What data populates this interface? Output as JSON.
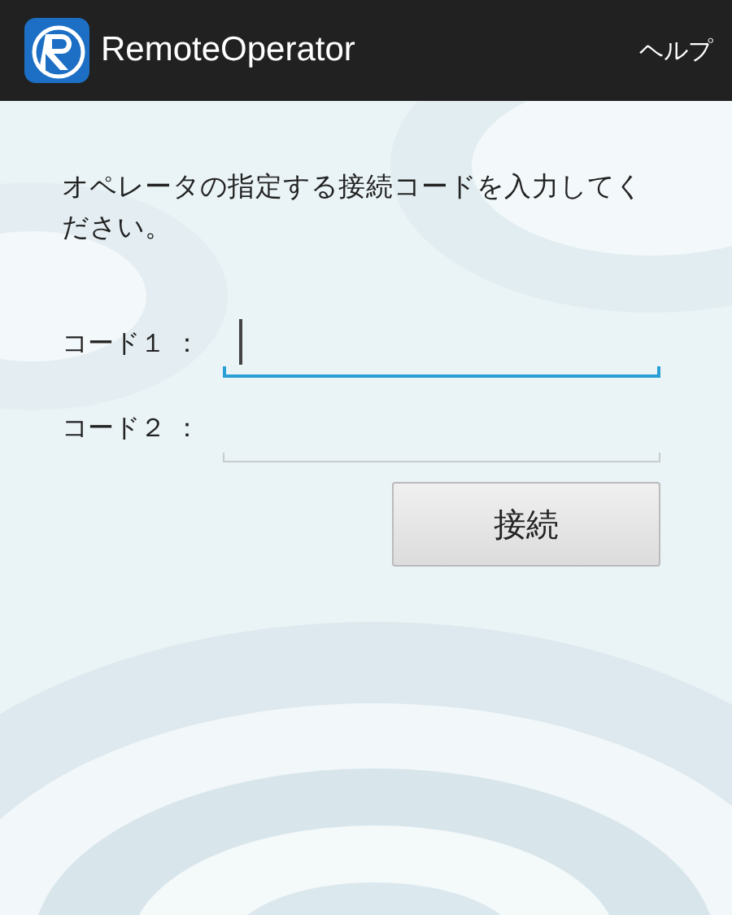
{
  "app_bar": {
    "title": "RemoteOperator",
    "menu": "ヘルプ"
  },
  "instruction": "オペレータの指定する接続コードを入力してください。",
  "fields": [
    {
      "label": "コード１ ：",
      "focused": true
    },
    {
      "label": "コード２ ：",
      "focused": false
    }
  ],
  "button": "接続"
}
